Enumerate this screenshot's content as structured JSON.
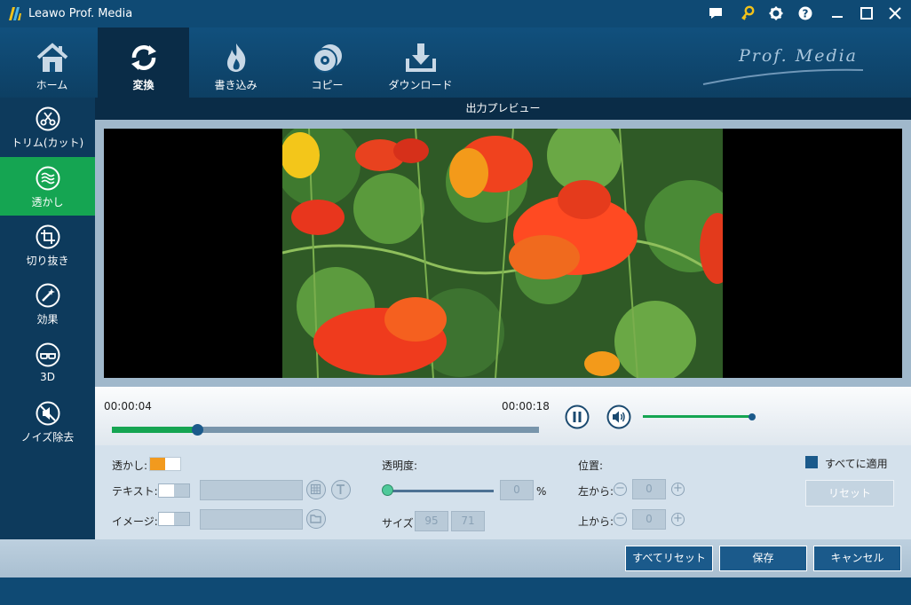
{
  "window": {
    "title": "Leawo Prof. Media"
  },
  "titlebar_icons": [
    "chat-icon",
    "key-icon",
    "gear-icon",
    "help-icon",
    "minimize-icon",
    "maximize-icon",
    "close-icon"
  ],
  "nav": {
    "tabs": [
      {
        "label": "ホーム",
        "icon": "home-icon",
        "active": false
      },
      {
        "label": "変換",
        "icon": "convert-icon",
        "active": true
      },
      {
        "label": "書き込み",
        "icon": "burn-icon",
        "active": false
      },
      {
        "label": "コピー",
        "icon": "copy-disc-icon",
        "active": false
      },
      {
        "label": "ダウンロード",
        "icon": "download-icon",
        "active": false
      }
    ],
    "brand": "Prof. Media"
  },
  "sidebar": {
    "items": [
      {
        "label": "トリム(カット)",
        "icon": "scissors-icon",
        "active": false
      },
      {
        "label": "透かし",
        "icon": "watermark-icon",
        "active": true
      },
      {
        "label": "切り抜き",
        "icon": "crop-icon",
        "active": false
      },
      {
        "label": "効果",
        "icon": "effect-wand-icon",
        "active": false
      },
      {
        "label": "3D",
        "icon": "3d-glasses-icon",
        "active": false
      },
      {
        "label": "ノイズ除去",
        "icon": "noise-removal-icon",
        "active": false
      }
    ]
  },
  "preview": {
    "header": "出力プレビュー"
  },
  "playback": {
    "current_time": "00:00:04",
    "total_time": "00:00:18",
    "progress": 0.2,
    "volume": 1.0
  },
  "watermark": {
    "label": "透かし:",
    "enabled": true,
    "text_label": "テキスト:",
    "text_enabled": false,
    "text_value": "",
    "image_label": "イメージ:",
    "image_enabled": false,
    "image_value": ""
  },
  "opacity": {
    "label": "透明度:",
    "value": "0",
    "unit": "%",
    "level": 0
  },
  "size": {
    "label": "サイズ:",
    "width": "95",
    "height": "71"
  },
  "position": {
    "label": "位置:",
    "left_label": "左から:",
    "left_value": "0",
    "top_label": "上から:",
    "top_value": "0"
  },
  "apply_all": {
    "label": "すべてに適用",
    "checked": true
  },
  "reset_label": "リセット",
  "actions": {
    "reset_all": "すべてリセット",
    "save": "保存",
    "cancel": "キャンセル"
  },
  "colors": {
    "accent_green": "#15a552",
    "nav_blue": "#0f4a74",
    "dark_panel": "#0a2c47",
    "button_blue": "#1b5a8b"
  }
}
